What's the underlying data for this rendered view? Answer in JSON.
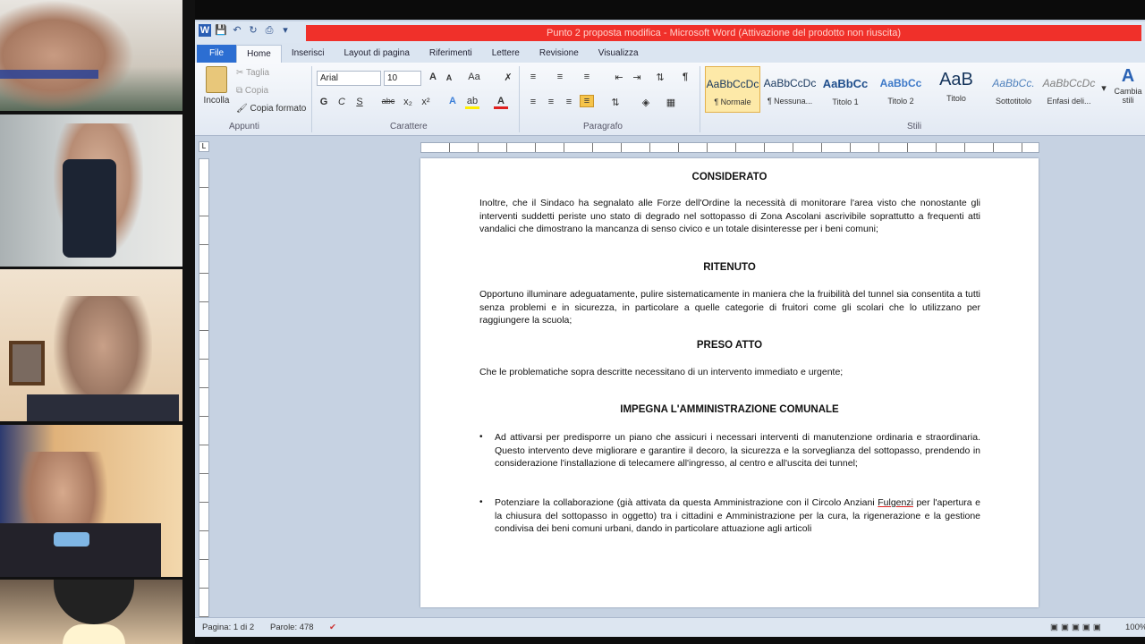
{
  "window": {
    "title": "Punto 2 proposta modifica  -  Microsoft Word (Attivazione del prodotto non riuscita)"
  },
  "tabs": [
    "File",
    "Home",
    "Inserisci",
    "Layout di pagina",
    "Riferimenti",
    "Lettere",
    "Revisione",
    "Visualizza"
  ],
  "ribbon": {
    "clipboard": {
      "paste": "Incolla",
      "cut": "Taglia",
      "copy": "Copia",
      "format_painter": "Copia formato",
      "label": "Appunti"
    },
    "font": {
      "name": "Arial",
      "size": "10",
      "label": "Carattere",
      "bold": "G",
      "italic": "C",
      "underline": "S",
      "strike": "abc",
      "subscript": "x₂",
      "superscript": "x²"
    },
    "paragraph_label": "Paragrafo",
    "styles": [
      {
        "preview": "AaBbCcDc",
        "name": "¶ Normale"
      },
      {
        "preview": "AaBbCcDc",
        "name": "¶ Nessuna..."
      },
      {
        "preview": "AaBbCc",
        "name": "Titolo 1"
      },
      {
        "preview": "AaBbCc",
        "name": "Titolo 2"
      },
      {
        "preview": "AaB",
        "name": "Titolo"
      },
      {
        "preview": "AaBbCc.",
        "name": "Sottotitolo"
      },
      {
        "preview": "AaBbCcDc",
        "name": "Enfasi deli..."
      }
    ],
    "styles_label": "Stili",
    "change_styles": "Cambia stili"
  },
  "document": {
    "heading1": "CONSIDERATO",
    "para1": "Inoltre, che il Sindaco ha segnalato alle Forze dell'Ordine la necessità di monitorare l'area visto che nonostante gli interventi suddetti periste uno stato di degrado nel sottopasso di Zona Ascolani ascrivibile soprattutto a frequenti atti vandalici che dimostrano la mancanza di senso civico e un totale disinteresse per i beni comuni;",
    "heading2": "RITENUTO",
    "para2": "Opportuno illuminare adeguatamente, pulire sistematicamente in maniera che la fruibilità del tunnel sia consentita a tutti senza problemi e in sicurezza, in particolare a quelle categorie di fruitori come gli scolari che lo utilizzano per raggiungere la scuola;",
    "heading3": "PRESO ATTO",
    "para3": "Che le problematiche sopra descritte necessitano di un intervento immediato e urgente;",
    "heading4": "IMPEGNA L'AMMINISTRAZIONE COMUNALE",
    "bullet_char": "•",
    "bullet1": "Ad attivarsi per predisporre un piano che assicuri i necessari interventi di manutenzione ordinaria e straordinaria. Questo intervento deve migliorare e garantire il decoro, la sicurezza e la sorveglianza del sottopasso, prendendo in considerazione l'installazione di telecamere all'ingresso, al centro e all'uscita dei tunnel;",
    "bullet2_a": "Potenziare la collaborazione (già attivata da questa Amministrazione con il Circolo Anziani ",
    "bullet2_name": "Fulgenzi",
    "bullet2_b": " per l'apertura e la chiusura del sottopasso in oggetto) tra i cittadini e Amministrazione per la cura, la rigenerazione e la gestione condivisa dei beni comuni urbani, dando in particolare attuazione agli articoli"
  },
  "status": {
    "page": "Pagina: 1 di 2",
    "words": "Parole: 478",
    "zoom": "100%"
  }
}
